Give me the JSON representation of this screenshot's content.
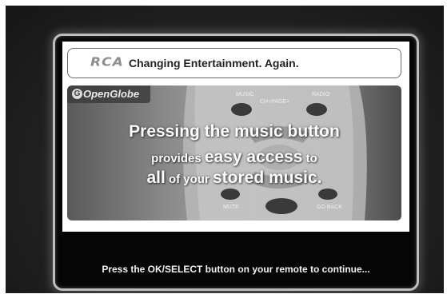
{
  "banner": {
    "logo_text": "RCA",
    "tagline": "Changing Entertainment. Again."
  },
  "badge": {
    "icon_glyph": "G",
    "text": "OpenGlobe"
  },
  "remote": {
    "button_labels": {
      "music": "MUSIC",
      "radio": "RADIO",
      "ch_page": "CH+PAGE+",
      "mute": "MUTE",
      "go_back": "GO BACK"
    }
  },
  "message": {
    "line1": "Pressing the music button",
    "line2_a": "provides ",
    "line2_b": "easy access",
    "line2_c": " to",
    "line3_a": "all",
    "line3_b": " of your ",
    "line3_c": "stored music."
  },
  "footer": {
    "instruction": "Press the OK/SELECT button on your remote to continue..."
  },
  "icons": [
    "openglobe-icon",
    "rca-logo"
  ]
}
